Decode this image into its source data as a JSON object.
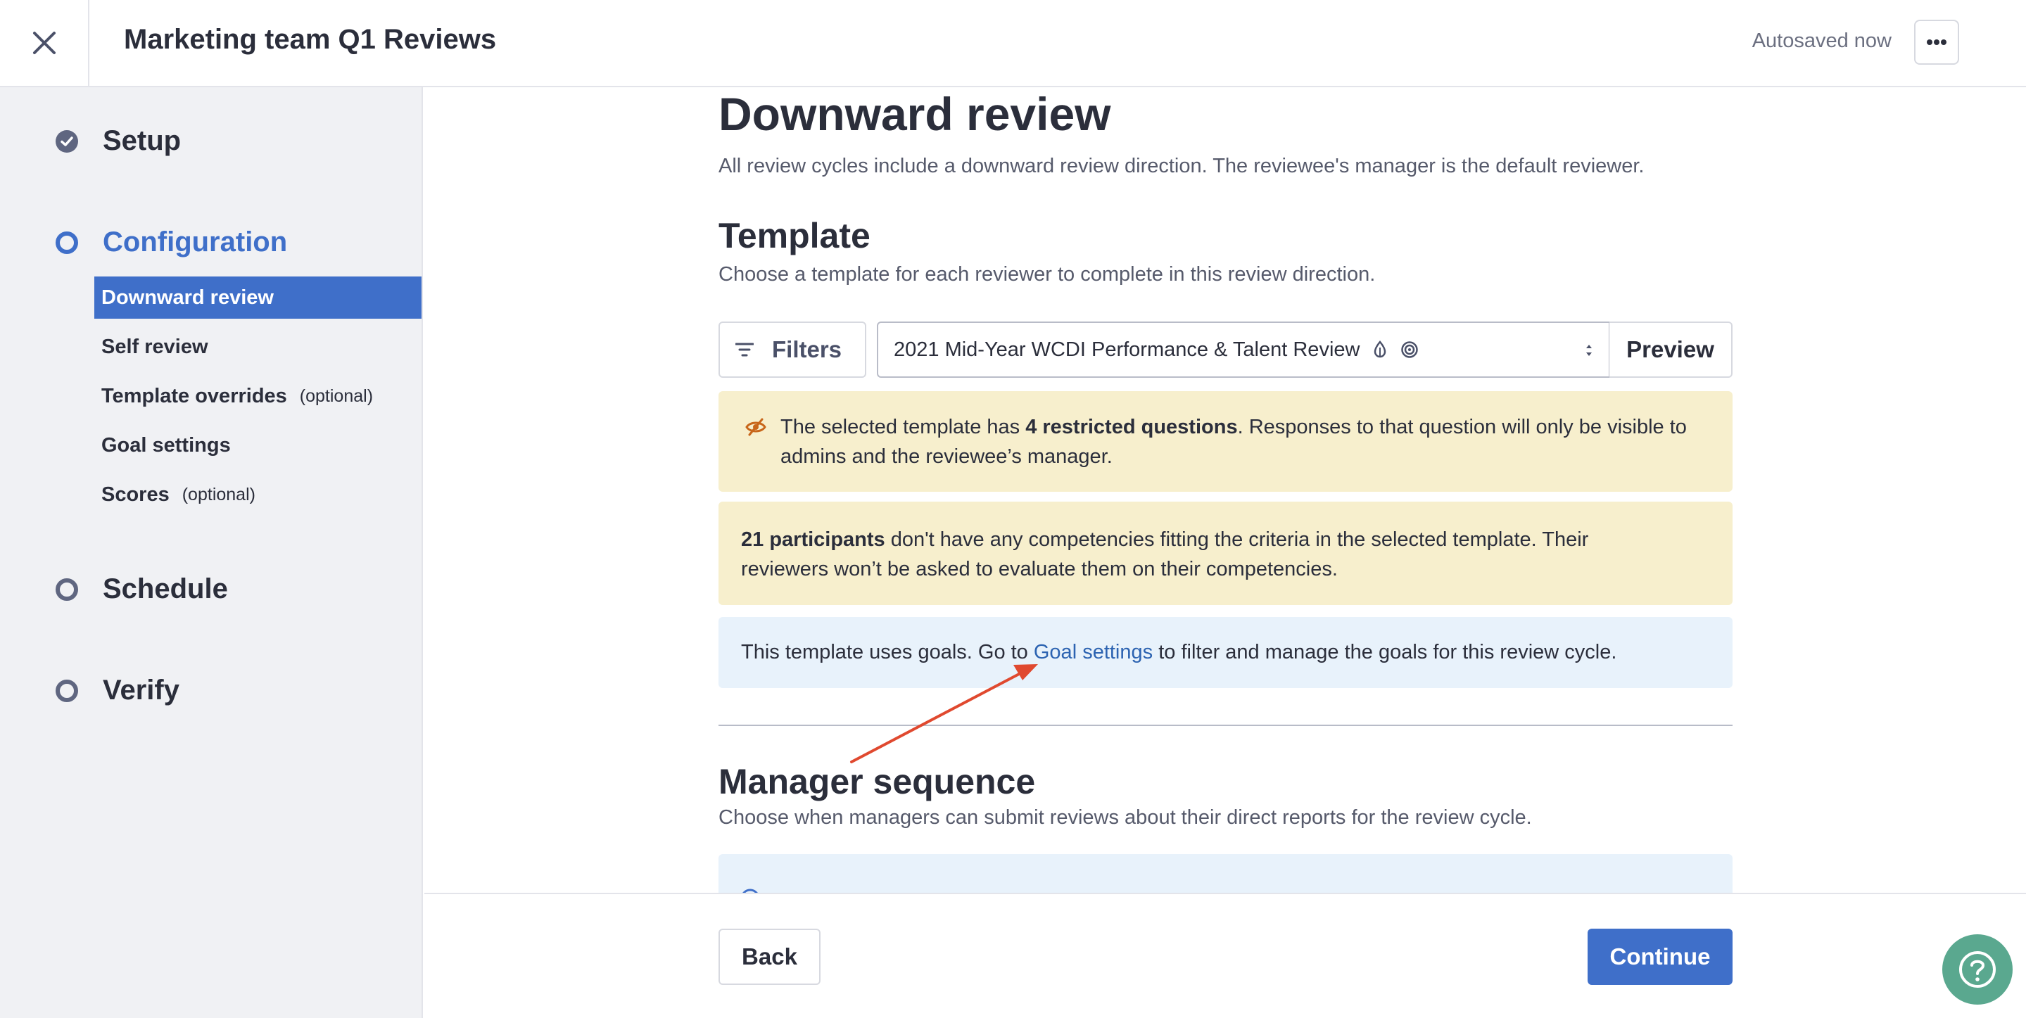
{
  "header": {
    "title": "Marketing team Q1 Reviews",
    "autosave_status": "Autosaved now"
  },
  "sidebar": {
    "steps": [
      {
        "label": "Setup",
        "state": "complete"
      },
      {
        "label": "Configuration",
        "state": "active"
      },
      {
        "label": "Schedule",
        "state": "pending"
      },
      {
        "label": "Verify",
        "state": "pending"
      }
    ],
    "config_items": [
      {
        "label": "Downward review",
        "optional": ""
      },
      {
        "label": "Self review",
        "optional": ""
      },
      {
        "label": "Template overrides",
        "optional": "(optional)"
      },
      {
        "label": "Goal settings",
        "optional": ""
      },
      {
        "label": "Scores",
        "optional": "(optional)"
      }
    ],
    "selected_item": "Downward review"
  },
  "main": {
    "title": "Downward review",
    "description": "All review cycles include a downward review direction. The reviewee's manager is the default reviewer.",
    "template": {
      "title": "Template",
      "description": "Choose a template for each reviewer to complete in this review direction.",
      "filters_label": "Filters",
      "selected_template": "2021 Mid-Year WCDI Performance & Talent Review",
      "preview_label": "Preview"
    },
    "banners": {
      "restricted": {
        "before": "The selected template has ",
        "bold": "4 restricted questions",
        "after_line1": ". Responses to that question will only be visible to",
        "line2": "admins and the reviewee’s manager."
      },
      "participants": {
        "bold": "21 participants",
        "after_line1": " don't have any competencies fitting the criteria in the selected template. Their",
        "line2": "reviewers won’t be asked to evaluate them on their competencies."
      },
      "goals": {
        "before": "This template uses goals. Go to ",
        "link": "Goal settings",
        "after": " to filter and manage the goals for this review cycle."
      }
    },
    "manager_sequence": {
      "title": "Manager sequence",
      "description": "Choose when managers can submit reviews about their direct reports for the review cycle."
    }
  },
  "footer": {
    "back_label": "Back",
    "continue_label": "Continue"
  },
  "colors": {
    "accent": "#3f6fc9",
    "warning_bg": "#f7efcd",
    "info_bg": "#e8f2fb",
    "link": "#2c63b1",
    "help_button": "#5aa88f",
    "annotation_arrow": "#e0492f"
  },
  "icons": {
    "close": "close-icon",
    "more": "more-horizontal-icon",
    "filter": "filter-icon",
    "restricted": "eye-off-icon",
    "help": "question-mark-icon"
  }
}
